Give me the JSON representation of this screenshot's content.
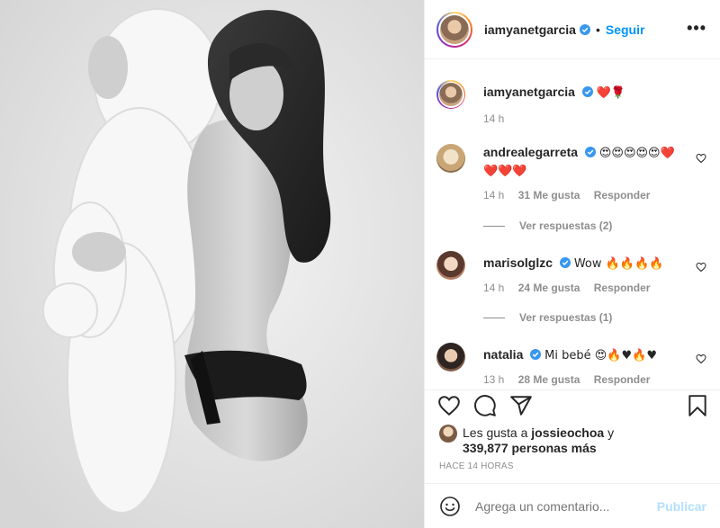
{
  "post": {
    "username": "iamyanetgarcia",
    "follow_label": "Seguir",
    "separator": "•",
    "more_label": "•••",
    "caption": "❤️🌹",
    "caption_time": "14 h"
  },
  "comments": [
    {
      "user": "andrealegarreta",
      "verified": true,
      "text": "😍😍😍😍😍❤️❤️❤️❤️",
      "time": "14 h",
      "likes": "31 Me gusta",
      "reply": "Responder",
      "view_replies": "Ver respuestas (2)"
    },
    {
      "user": "marisolglzc",
      "verified": true,
      "text": "Wow 🔥🔥🔥🔥",
      "time": "14 h",
      "likes": "24 Me gusta",
      "reply": "Responder",
      "view_replies": "Ver respuestas (1)"
    },
    {
      "user": "natalia",
      "verified": true,
      "text": "Mi bebé 😍🔥♥🔥♥",
      "time": "13 h",
      "likes": "28 Me gusta",
      "reply": "Responder"
    }
  ],
  "likes": {
    "prefix": "Les gusta a",
    "user": "jossieochoa",
    "suffix": "y",
    "others": "339,877 personas más"
  },
  "timestamp": "HACE 14 HORAS",
  "compose": {
    "placeholder": "Agrega un comentario...",
    "post_label": "Publicar"
  },
  "icons": {
    "like": "heart-outline-icon",
    "comment": "comment-bubble-icon",
    "share": "paper-plane-icon",
    "save": "bookmark-icon",
    "emoji": "smiley-icon",
    "verified": "verified-badge-icon",
    "comment_like": "small-heart-icon"
  },
  "colors": {
    "link_blue": "#0095f6",
    "muted": "#8e8e8e",
    "verified": "#3897f0",
    "post_disabled": "#b2dffc"
  }
}
